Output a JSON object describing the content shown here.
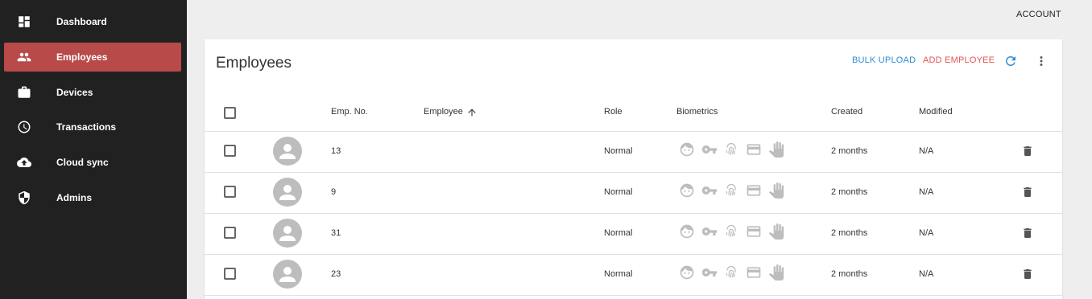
{
  "sidebar": {
    "items": [
      {
        "label": "Dashboard",
        "icon": "dashboard-icon",
        "active": false
      },
      {
        "label": "Employees",
        "icon": "people-icon",
        "active": true
      },
      {
        "label": "Devices",
        "icon": "briefcase-icon",
        "active": false
      },
      {
        "label": "Transactions",
        "icon": "clock-icon",
        "active": false
      },
      {
        "label": "Cloud sync",
        "icon": "cloud-upload-icon",
        "active": false
      },
      {
        "label": "Admins",
        "icon": "shield-icon",
        "active": false
      }
    ],
    "active_color": "#b84a4a"
  },
  "header": {
    "account_label": "ACCOUNT"
  },
  "card": {
    "title": "Employees",
    "bulk_upload_label": "BULK UPLOAD",
    "add_employee_label": "ADD EMPLOYEE",
    "accent_blue": "#2f8cd9",
    "accent_red": "#e55353"
  },
  "table": {
    "columns": {
      "emp_no": "Emp. No.",
      "employee": "Employee",
      "role": "Role",
      "biometrics": "Biometrics",
      "created": "Created",
      "modified": "Modified"
    },
    "sort_column": "employee",
    "biometric_icons": [
      "face-icon",
      "key-icon",
      "fingerprint-icon",
      "card-icon",
      "palm-icon"
    ],
    "rows": [
      {
        "emp_no": "13",
        "employee": "",
        "role": "Normal",
        "created": "2 months",
        "modified": "N/A"
      },
      {
        "emp_no": "9",
        "employee": "",
        "role": "Normal",
        "created": "2 months",
        "modified": "N/A"
      },
      {
        "emp_no": "31",
        "employee": "",
        "role": "Normal",
        "created": "2 months",
        "modified": "N/A"
      },
      {
        "emp_no": "23",
        "employee": "",
        "role": "Normal",
        "created": "2 months",
        "modified": "N/A"
      }
    ]
  }
}
